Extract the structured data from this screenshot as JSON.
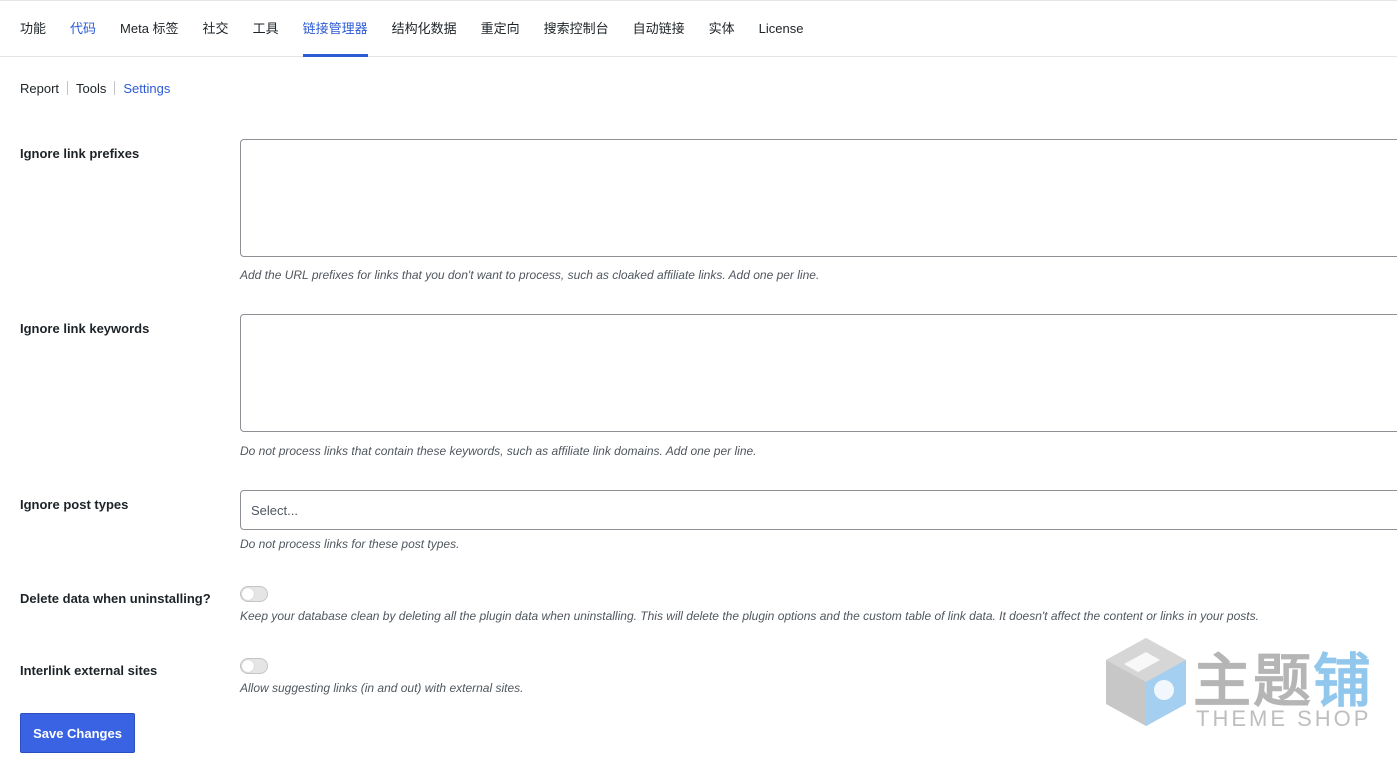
{
  "tabs": [
    {
      "label": "功能"
    },
    {
      "label": "代码"
    },
    {
      "label": "Meta 标签"
    },
    {
      "label": "社交"
    },
    {
      "label": "工具"
    },
    {
      "label": "链接管理器"
    },
    {
      "label": "结构化数据"
    },
    {
      "label": "重定向"
    },
    {
      "label": "搜索控制台"
    },
    {
      "label": "自动链接"
    },
    {
      "label": "实体"
    },
    {
      "label": "License"
    }
  ],
  "active_tab": "链接管理器",
  "subnav": [
    {
      "label": "Report"
    },
    {
      "label": "Tools"
    },
    {
      "label": "Settings"
    }
  ],
  "settings": {
    "ignore_prefixes": {
      "label": "Ignore link prefixes",
      "value": "",
      "description": "Add the URL prefixes for links that you don't want to process, such as cloaked affiliate links. Add one per line."
    },
    "ignore_keywords": {
      "label": "Ignore link keywords",
      "value": "",
      "description": "Do not process links that contain these keywords, such as affiliate link domains. Add one per line."
    },
    "ignore_post_types": {
      "label": "Ignore post types",
      "placeholder": "Select...",
      "description": "Do not process links for these post types."
    },
    "delete_data": {
      "label": "Delete data when uninstalling?",
      "enabled": false,
      "description": "Keep your database clean by deleting all the plugin data when uninstalling. This will delete the plugin options and the custom table of link data. It doesn't affect the content or links in your posts."
    },
    "interlink_external": {
      "label": "Interlink external sites",
      "enabled": false,
      "description": "Allow suggesting links (in and out) with external sites."
    }
  },
  "save_button": "Save Changes",
  "watermark": {
    "cn_text_main": "主题",
    "cn_text_accent": "铺",
    "en_text": "THEME SHOP"
  },
  "colors": {
    "accent": "#2c5bd6",
    "button": "#3a63e4"
  }
}
